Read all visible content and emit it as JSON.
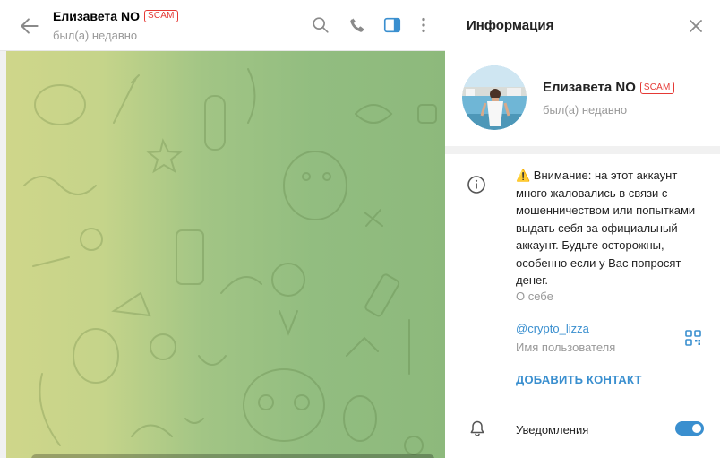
{
  "chat": {
    "name": "Елизавета NO",
    "scam_badge": "SCAM",
    "status": "был(а) недавно"
  },
  "header_icons": [
    "back-arrow-icon",
    "search-icon",
    "phone-icon",
    "sidebar-toggle-icon",
    "more-vert-icon"
  ],
  "info": {
    "title": "Информация",
    "profile": {
      "name": "Елизавета NO",
      "scam_badge": "SCAM",
      "status": "был(а) недавно"
    },
    "warning": "⚠️ Внимание: на этот аккаунт много жаловались в связи с мошенничеством или попытками выдать себя за официальный аккаунт. Будьте осторожны, особенно если у Вас попросят денег.",
    "about_label": "О себе",
    "username": "@crypto_lizza",
    "username_label": "Имя пользователя",
    "add_contact": "ДОБАВИТЬ КОНТАКТ",
    "notifications_label": "Уведомления",
    "notifications_on": true
  },
  "colors": {
    "accent": "#3a8fcf",
    "scam": "#e53935",
    "muted": "#999999"
  }
}
